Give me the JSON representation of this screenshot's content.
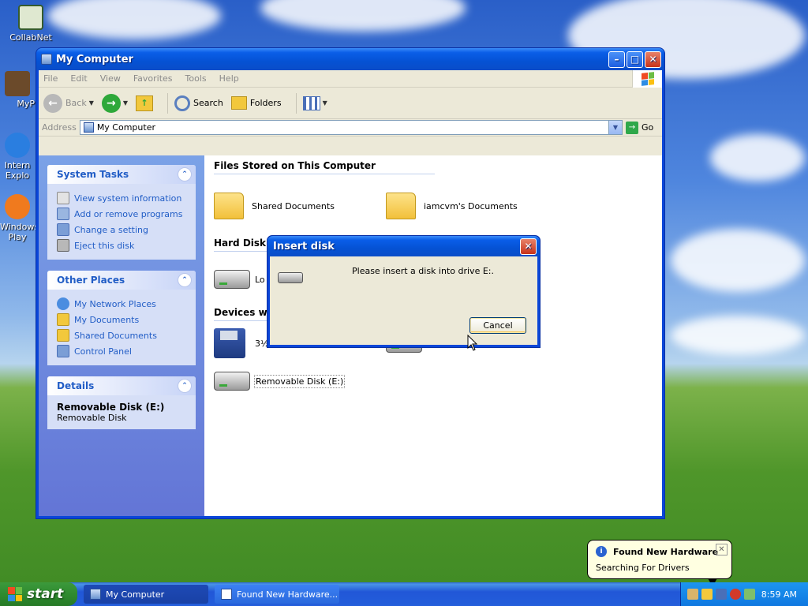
{
  "desktop": {
    "icons": [
      {
        "label": "CollabNet"
      },
      {
        "label": "MyP"
      },
      {
        "label": "Intern Explo"
      },
      {
        "label": "Windows Play"
      }
    ]
  },
  "window": {
    "title": "My Computer",
    "menu": [
      "File",
      "Edit",
      "View",
      "Favorites",
      "Tools",
      "Help"
    ],
    "toolbar": {
      "back": "Back",
      "search": "Search",
      "folders": "Folders"
    },
    "address": {
      "label": "Address",
      "value": "My Computer",
      "go": "Go"
    },
    "tasks": {
      "system": {
        "title": "System Tasks",
        "items": [
          "View system information",
          "Add or remove programs",
          "Change a setting",
          "Eject this disk"
        ]
      },
      "places": {
        "title": "Other Places",
        "items": [
          "My Network Places",
          "My Documents",
          "Shared Documents",
          "Control Panel"
        ]
      },
      "details": {
        "title": "Details",
        "name": "Removable Disk (E:)",
        "type": "Removable Disk"
      }
    },
    "groups": {
      "files": {
        "title": "Files Stored on This Computer",
        "items": [
          "Shared Documents",
          "iamcvm's Documents"
        ]
      },
      "hdd": {
        "title": "Hard Disk Drives",
        "items": [
          "Lo"
        ]
      },
      "devices": {
        "title": "Devices with",
        "items": [
          "3½",
          "Removable Disk (E:)"
        ]
      }
    }
  },
  "dialog": {
    "title": "Insert disk",
    "message": "Please insert a disk into drive E:.",
    "cancel": "Cancel"
  },
  "balloon": {
    "title": "Found New Hardware",
    "body": "Searching For Drivers"
  },
  "taskbar": {
    "start": "start",
    "items": [
      "My Computer",
      "Found New Hardware..."
    ],
    "clock": "8:59 AM"
  },
  "colors": {
    "xp_blue": "#0a46d8",
    "task_link": "#215dc6",
    "start_green": "#2f8b2f"
  }
}
